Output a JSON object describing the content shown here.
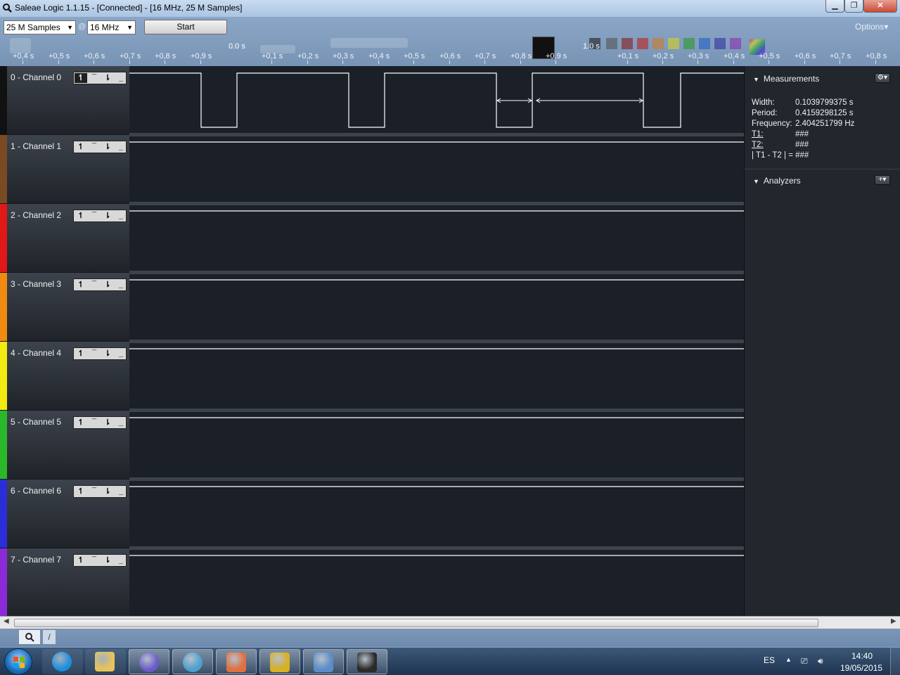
{
  "window": {
    "title": "Saleae Logic 1.1.15 - [Connected] - [16 MHz, 25 M Samples]",
    "minimize": "▁",
    "maximize": "❐",
    "close": "✕"
  },
  "toolbar": {
    "samples_value": "25 M Samples",
    "at_sign": "@",
    "rate_value": "16 MHz",
    "start_label": "Start",
    "options_label": "Options▾"
  },
  "ruler": {
    "labels": [
      "+0,4 s",
      "+0,5 s",
      "+0,6 s",
      "+0,7 s",
      "+0,8 s",
      "+0,9 s",
      "+0,1 s",
      "+0,2 s",
      "+0,3 s",
      "+0,4 s",
      "+0,5 s",
      "+0,6 s",
      "+0,7 s",
      "+0,8 s",
      "+0,9 s",
      "+0,1 s",
      "+0,2 s",
      "+0,3 s",
      "+0,4 s",
      "+0,5 s",
      "+0,6 s",
      "+0,7 s",
      "+0,8 s"
    ],
    "marker_start": "0.0 s",
    "marker_end": "1.0 s"
  },
  "channels": [
    {
      "name": "0 - Channel 0",
      "color": "#111111"
    },
    {
      "name": "1 - Channel 1",
      "color": "#7a4a22"
    },
    {
      "name": "2 - Channel 2",
      "color": "#e01818"
    },
    {
      "name": "3 - Channel 3",
      "color": "#f08a10"
    },
    {
      "name": "4 - Channel 4",
      "color": "#f2ea10"
    },
    {
      "name": "5 - Channel 5",
      "color": "#2ab82a"
    },
    {
      "name": "6 - Channel 6",
      "color": "#2b2ed8"
    },
    {
      "name": "7 - Channel 7",
      "color": "#8b2ad8"
    }
  ],
  "trigger_icons": [
    "rising-edge-icon",
    "high-level-icon",
    "falling-edge-icon",
    "low-level-icon"
  ],
  "measurements": {
    "header": "Measurements",
    "width_label": "Width:",
    "width_value": "0.1039799375 s",
    "period_label": "Period:",
    "period_value": "0.4159298125 s",
    "frequency_label": "Frequency:",
    "frequency_value": "2.404251799 Hz",
    "t1_label": "T1:",
    "t1_value": "###",
    "t2_label": "T2:",
    "t2_value": "###",
    "diff_label": "| T1 - T2 | =",
    "diff_value": "###"
  },
  "analyzers": {
    "header": "Analyzers",
    "add_label": "+▾"
  },
  "settings_label": "⚙▾",
  "status": {
    "search_icon": "search-icon",
    "next_label": "/"
  },
  "taskbar": {
    "language": "ES",
    "time": "14:40",
    "date": "19/05/2015",
    "apps": [
      "internet-explorer-icon",
      "file-explorer-icon",
      "media-app-icon",
      "atom-app-icon",
      "paint-app-icon",
      "archive-app-icon",
      "calculator-icon",
      "saleae-logic-icon"
    ]
  }
}
